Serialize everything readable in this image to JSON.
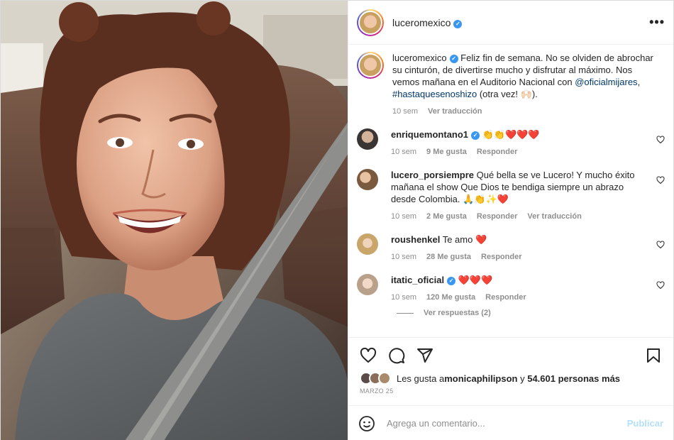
{
  "post": {
    "author": "luceromexico",
    "more_label": "•••",
    "verified_mark": "✓"
  },
  "caption": {
    "username": "luceromexico",
    "text_before": " Feliz fin de semana. No se olviden de abrochar su cinturón, de divertirse mucho y disfrutar al máximo. Nos vemos mañana en el Auditorio Nacional con ",
    "mention": "@oficialmijares",
    "text_mid": ", ",
    "hashtag": "#hastaquesenoshizo",
    "text_after": " (otra vez! 🙌🏻).",
    "time": "10 sem",
    "translate": "Ver traducción"
  },
  "comments": [
    {
      "username": "enriquemontano1",
      "verified": true,
      "text": " 👏👏❤️❤️❤️",
      "time": "10 sem",
      "likes": "9 Me gusta",
      "reply": "Responder",
      "translate": ""
    },
    {
      "username": "lucero_porsiempre",
      "verified": false,
      "text": " Qué bella se ve Lucero! Y mucho éxito mañana el show Que Dios te bendiga siempre un abrazo desde Colombia. 🙏👏✨❤️",
      "time": "10 sem",
      "likes": "2 Me gusta",
      "reply": "Responder",
      "translate": "Ver traducción"
    },
    {
      "username": "roushenkel",
      "verified": false,
      "text": " Te amo ❤️",
      "time": "10 sem",
      "likes": "28 Me gusta",
      "reply": "Responder",
      "translate": ""
    },
    {
      "username": "itatic_oficial",
      "verified": true,
      "text": " ❤️❤️❤️",
      "time": "10 sem",
      "likes": "120 Me gusta",
      "reply": "Responder",
      "translate": ""
    }
  ],
  "replies_label": "Ver respuestas (2)",
  "likes_line": {
    "prefix": "Les gusta a ",
    "user": "monicaphilipson",
    "mid": " y ",
    "count": "54.601 personas más"
  },
  "date": "MARZO 25",
  "add_comment": {
    "placeholder": "Agrega un comentario...",
    "publish": "Publicar"
  },
  "colors": {
    "verified": "#3897f0",
    "link": "#00376b",
    "publish_disabled": "#b2dffc",
    "meta_gray": "#8e8e8e"
  },
  "icons": [
    "heart-icon",
    "comment-icon",
    "share-icon",
    "bookmark-icon",
    "emoji-icon",
    "more-icon"
  ]
}
